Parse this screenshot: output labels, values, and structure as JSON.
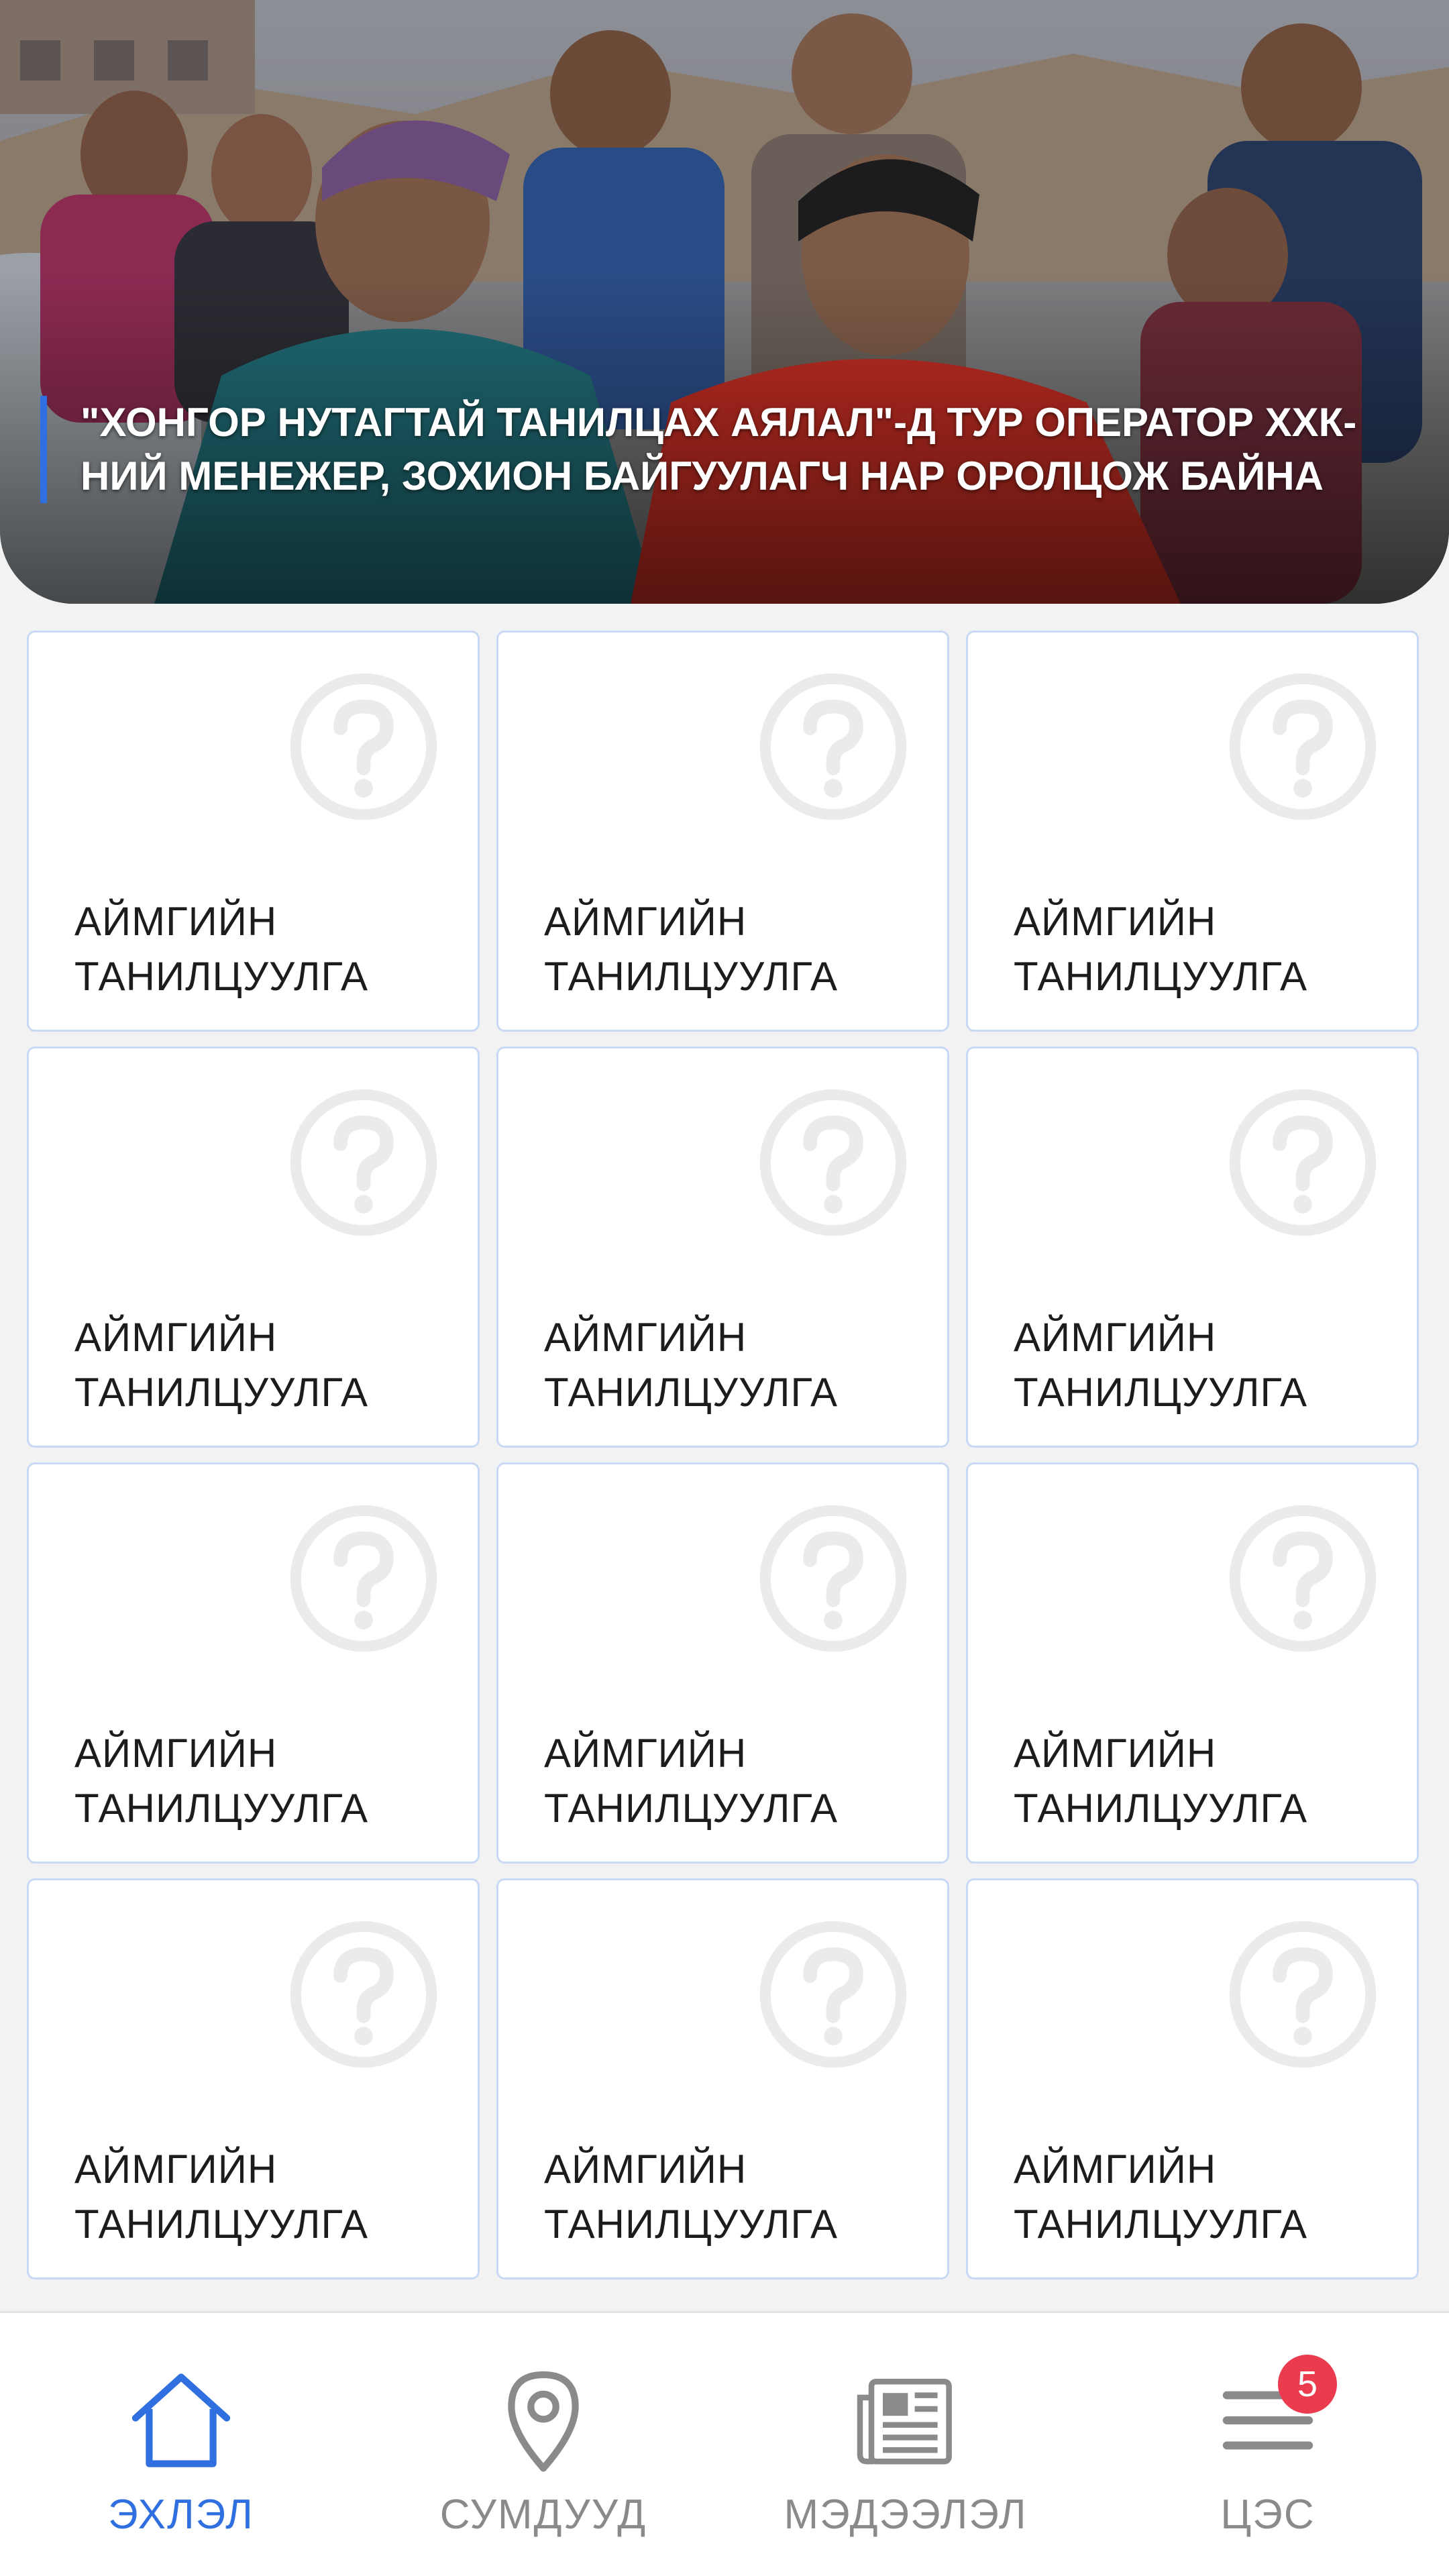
{
  "hero": {
    "caption": "\"ХОНГОР НУТАГТАЙ ТАНИЛЦАХ АЯЛАЛ\"-Д ТУР ОПЕРАТОР ХХК-НИЙ МЕНЕЖЕР, ЗОХИОН БАЙГУУЛАГЧ НАР ОРОЛЦОЖ БАЙНА",
    "accent_color": "#2f6fe0"
  },
  "grid": {
    "items": [
      {
        "label": "АЙМГИЙН ТАНИЛЦУУЛГА",
        "icon": "question-circle-icon"
      },
      {
        "label": "АЙМГИЙН ТАНИЛЦУУЛГА",
        "icon": "question-circle-icon"
      },
      {
        "label": "АЙМГИЙН ТАНИЛЦУУЛГА",
        "icon": "question-circle-icon"
      },
      {
        "label": "АЙМГИЙН ТАНИЛЦУУЛГА",
        "icon": "question-circle-icon"
      },
      {
        "label": "АЙМГИЙН ТАНИЛЦУУЛГА",
        "icon": "question-circle-icon"
      },
      {
        "label": "АЙМГИЙН ТАНИЛЦУУЛГА",
        "icon": "question-circle-icon"
      },
      {
        "label": "АЙМГИЙН ТАНИЛЦУУЛГА",
        "icon": "question-circle-icon"
      },
      {
        "label": "АЙМГИЙН ТАНИЛЦУУЛГА",
        "icon": "question-circle-icon"
      },
      {
        "label": "АЙМГИЙН ТАНИЛЦУУЛГА",
        "icon": "question-circle-icon"
      },
      {
        "label": "АЙМГИЙН ТАНИЛЦУУЛГА",
        "icon": "question-circle-icon"
      },
      {
        "label": "АЙМГИЙН ТАНИЛЦУУЛГА",
        "icon": "question-circle-icon"
      },
      {
        "label": "АЙМГИЙН ТАНИЛЦУУЛГА",
        "icon": "question-circle-icon"
      }
    ]
  },
  "nav": {
    "items": [
      {
        "label": "ЭХЛЭЛ",
        "icon": "home-icon",
        "active": true
      },
      {
        "label": "СУМДУУД",
        "icon": "location-pin-icon",
        "active": false
      },
      {
        "label": "МЭДЭЭЛЭЛ",
        "icon": "newspaper-icon",
        "active": false
      },
      {
        "label": "ЦЭС",
        "icon": "hamburger-menu-icon",
        "active": false,
        "badge": "5"
      }
    ],
    "active_color": "#2f6fe0",
    "inactive_color": "#8a8a8a",
    "badge_color": "#ea3b4f"
  }
}
